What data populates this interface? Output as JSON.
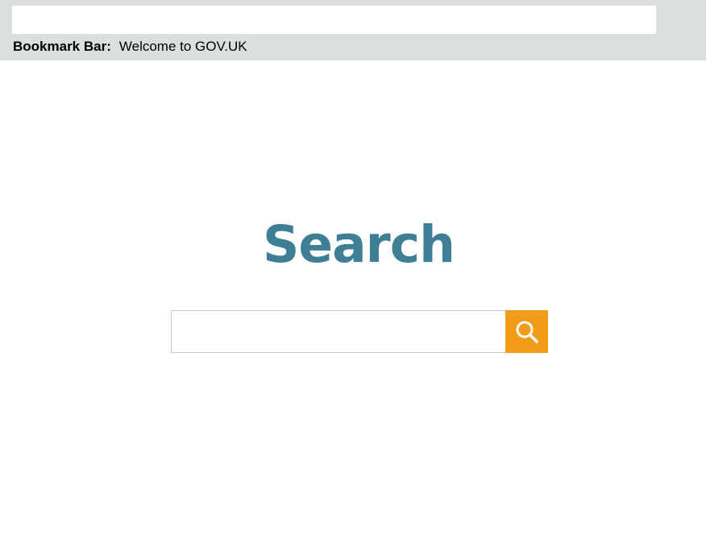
{
  "browser": {
    "address_value": "",
    "bookmark_bar_label": "Bookmark Bar:",
    "bookmarks": [
      {
        "label": "Welcome to GOV.UK"
      }
    ]
  },
  "main": {
    "title": "Search",
    "search": {
      "value": "",
      "placeholder": "",
      "button_icon": "search-icon"
    }
  },
  "colors": {
    "chrome_bg": "#dadfdf",
    "title": "#3f7f95",
    "search_button": "#f39c1a"
  }
}
